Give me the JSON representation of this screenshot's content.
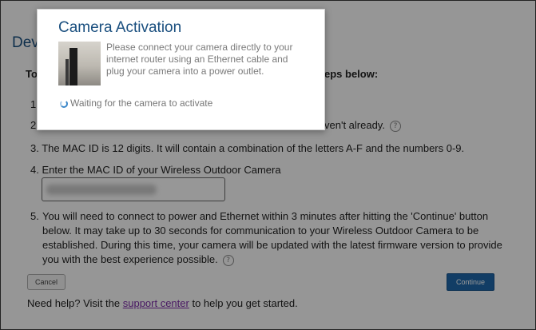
{
  "page": {
    "title": "Devi",
    "intro_start": "To",
    "intro_end": "eps below:",
    "steps": {
      "s1": {
        "num": "1"
      },
      "s2": {
        "num": "2",
        "text": "ven't already."
      },
      "s3": {
        "num": "3.",
        "text": "The MAC ID is 12 digits. It will contain a combination of the letters A-F and the numbers 0-9."
      },
      "s4": {
        "num": "4.",
        "text": "Enter the MAC ID of your Wireless Outdoor Camera"
      },
      "s5": {
        "num": "5.",
        "text": "You will need to connect to power and Ethernet within 3 minutes after hitting the 'Continue' button below. It may take up to 30 seconds for communication to your Wireless Outdoor Camera to be established. During this time, your camera will be updated with the latest firmware version to provide you with the best experience possible."
      }
    },
    "help_icon_glyph": "?",
    "cancel_label": "Cancel",
    "continue_label": "Continue",
    "help_prefix": "Need help? Visit the ",
    "help_link": "support center",
    "help_suffix": " to help you get started.",
    "colors": {
      "title": "#1a4f7f",
      "continue_bg": "#1f66a8",
      "link": "#7b2ba6"
    }
  },
  "modal": {
    "title": "Camera Activation",
    "message": "Please connect your camera directly to your internet router using an Ethernet cable and plug your camera into a power outlet.",
    "status": "Waiting for the camera to activate",
    "spinner_icon": "loading-spinner-icon"
  }
}
